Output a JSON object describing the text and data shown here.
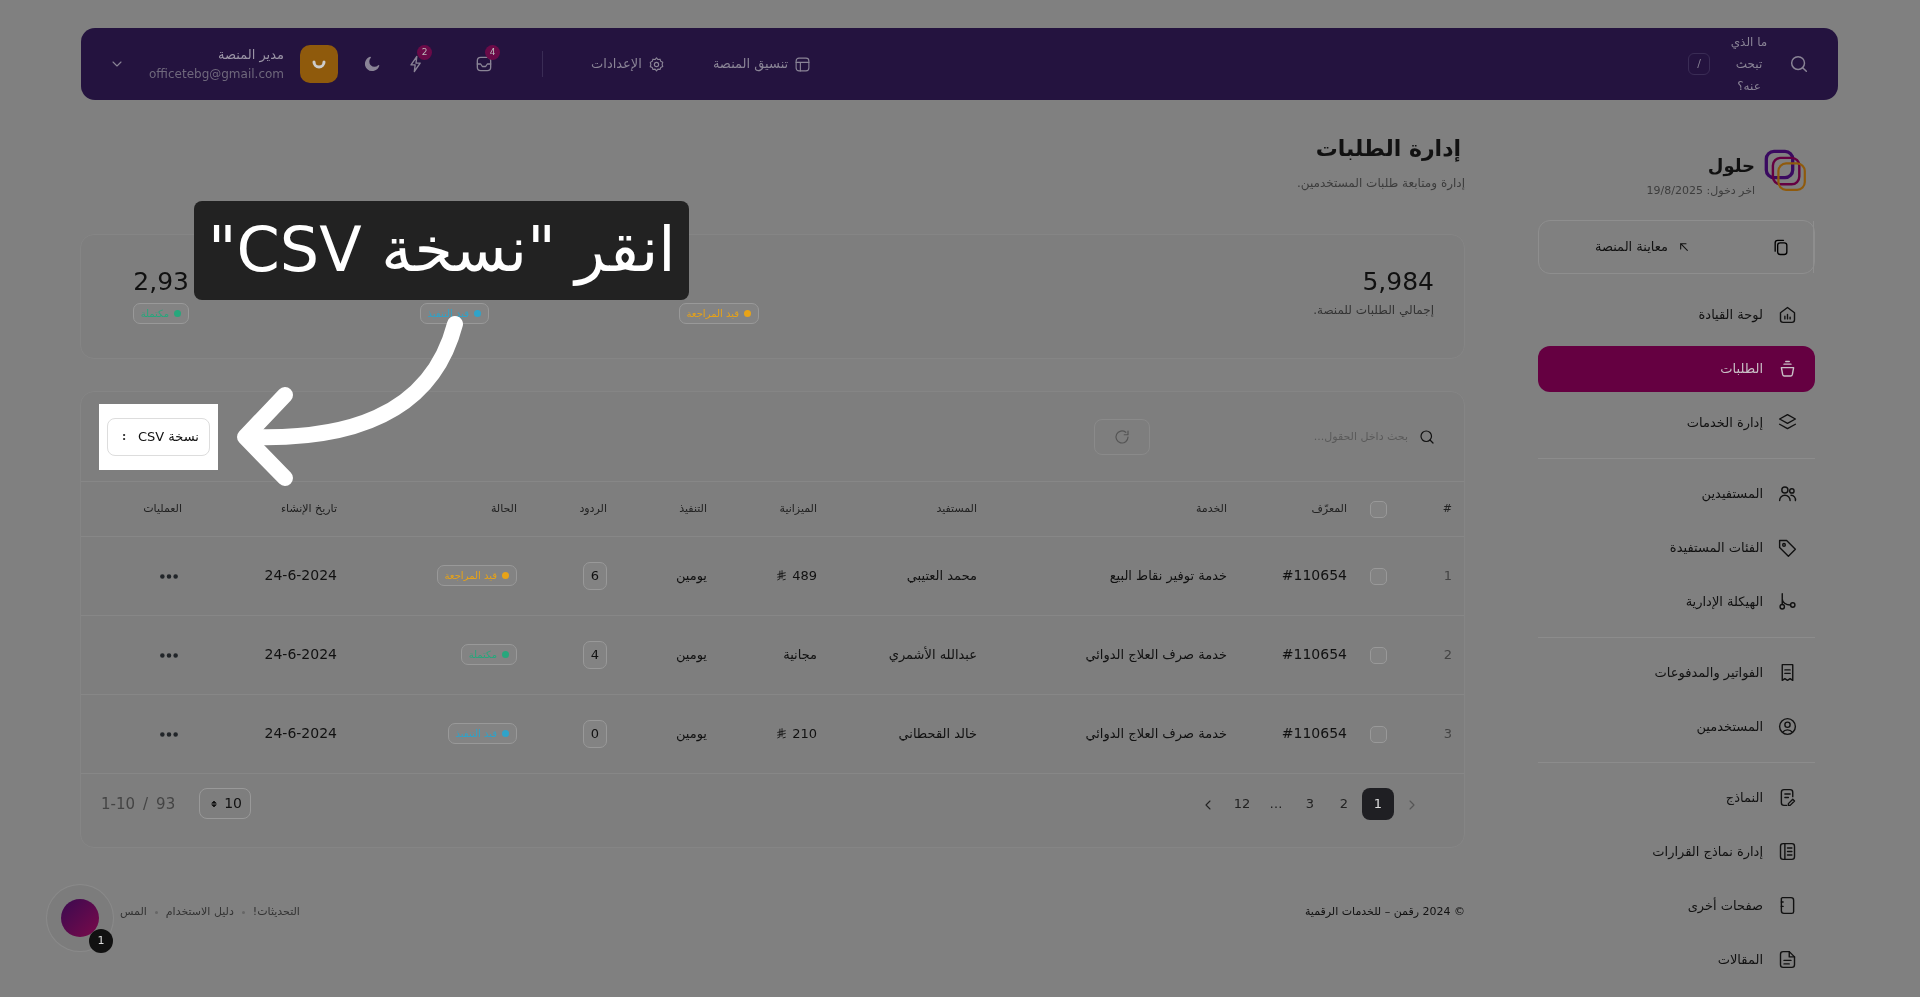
{
  "topbar": {
    "search_placeholder": "ما الذي تبحث عنه؟",
    "shortcut": "/",
    "links": [
      {
        "label": "تنسيق المنصة"
      },
      {
        "label": "الإعدادات"
      }
    ],
    "notifications": [
      {
        "count": "4"
      },
      {
        "count": "2"
      }
    ],
    "user": {
      "name": "مدير المنصة",
      "email": "officetebg@gmail.com"
    }
  },
  "sidebar": {
    "brand": "حلول",
    "last_login": "اخر دخول: 19/8/2025",
    "preview_button": "معاينة المنصة",
    "groups": [
      [
        {
          "label": "لوحة القيادة",
          "selected": false
        },
        {
          "label": "الطلبات",
          "selected": true
        },
        {
          "label": "إدارة الخدمات",
          "selected": false
        }
      ],
      [
        {
          "label": "المستفيدين",
          "selected": false
        },
        {
          "label": "الفئات المستفيدة",
          "selected": false
        },
        {
          "label": "الهيكلة الإدارية",
          "selected": false
        }
      ],
      [
        {
          "label": "الفواتير والمدفوعات",
          "selected": false
        },
        {
          "label": "المستخدمين",
          "selected": false
        }
      ],
      [
        {
          "label": "النماذج",
          "selected": false
        },
        {
          "label": "إدارة نماذج القرارات",
          "selected": false
        },
        {
          "label": "صفحات أخرى",
          "selected": false
        },
        {
          "label": "المقالات",
          "selected": false
        }
      ]
    ]
  },
  "page": {
    "title": "إدارة الطلبات",
    "subtitle": "إدارة ومتابعة طلبات المستخدمين."
  },
  "stats": [
    {
      "kind": "total",
      "value": "5,984",
      "label": "إجمالي الطلبات للمنصة."
    },
    {
      "kind": "status",
      "status": "قيد المراجعة",
      "color": "#e8a317"
    },
    {
      "kind": "status",
      "status": "قيد التنفيذ",
      "color": "#2fa3c9"
    },
    {
      "kind": "status",
      "value": "2,93",
      "status": "مكتملة",
      "color": "#27a77c"
    }
  ],
  "table": {
    "search_placeholder": "بحث داخل الحقول...",
    "export_button": "نسخة CSV",
    "columns": [
      "#",
      "المعرّف",
      "الخدمة",
      "المستفيد",
      "الميزانية",
      "التنفيذ",
      "الردود",
      "الحالة",
      "تاريخ الإنشاء",
      "العمليات"
    ],
    "header_checked": false,
    "rows": [
      {
        "index": "1",
        "checked": false,
        "id": "#110654",
        "service": "خدمة توفير نقاط البيع",
        "beneficiary": "محمد العتيبي",
        "budget": "489",
        "currency": true,
        "execution": "يومين",
        "replies": "6",
        "status": "قيد المراجعة",
        "color": "#e8a317",
        "created": "24-6-2024"
      },
      {
        "index": "2",
        "checked": false,
        "id": "#110654",
        "service": "خدمة صرف العلاج الدوائي",
        "beneficiary": "عبدالله الأشمري",
        "budget": "مجانية",
        "currency": false,
        "execution": "يومين",
        "replies": "4",
        "status": "مكتملة",
        "color": "#27a77c",
        "created": "24-6-2024"
      },
      {
        "index": "3",
        "checked": false,
        "id": "#110654",
        "service": "خدمة صرف العلاج الدوائي",
        "beneficiary": "خالد القحطاني",
        "budget": "210",
        "currency": true,
        "execution": "يومين",
        "replies": "0",
        "status": "قيد التنفيذ",
        "color": "#2fa3c9",
        "created": "24-6-2024"
      }
    ]
  },
  "pagination": {
    "pages": [
      {
        "label": "1",
        "selected": true
      },
      {
        "label": "2",
        "selected": false
      },
      {
        "label": "3",
        "selected": false
      },
      {
        "label": "…",
        "selected": false
      },
      {
        "label": "12",
        "selected": false
      }
    ],
    "per_page": "10",
    "range": "1-10",
    "separator": "/",
    "total": "93"
  },
  "footer": {
    "copyright": "© 2024 رقمن – للخدمات الرقمية",
    "links": [
      "التحديثات!",
      "دليل الاستخدام",
      "المس"
    ]
  },
  "chat": {
    "badge": "1"
  },
  "callout": {
    "text": "انقر \"نسخة CSV\""
  }
}
